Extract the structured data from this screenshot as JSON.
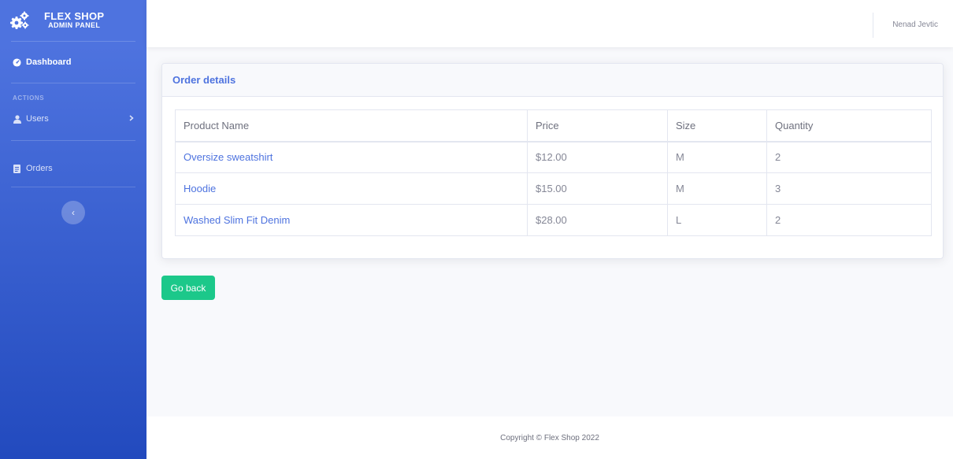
{
  "sidebar": {
    "brand_title": "FLEX SHOP",
    "brand_subtitle": "ADMIN PANEL",
    "dashboard_label": "Dashboard",
    "heading_actions": "ACTIONS",
    "users_label": "Users",
    "orders_label": "Orders",
    "toggle_glyph": "‹"
  },
  "topbar": {
    "user_name": "Nenad Jevtic"
  },
  "card": {
    "title": "Order details",
    "columns": [
      "Product Name",
      "Price",
      "Size",
      "Quantity"
    ],
    "rows": [
      {
        "product": "Oversize sweatshirt",
        "price": "$12.00",
        "size": "M",
        "quantity": "2"
      },
      {
        "product": "Hoodie",
        "price": "$15.00",
        "size": "M",
        "quantity": "3"
      },
      {
        "product": "Washed Slim Fit Denim",
        "price": "$28.00",
        "size": "L",
        "quantity": "2"
      }
    ]
  },
  "actions": {
    "go_back_label": "Go back"
  },
  "footer": {
    "copyright": "Copyright © Flex Shop 2022"
  },
  "colors": {
    "primary": "#4e73df",
    "success": "#1cc88a",
    "sidebar_bottom": "#224abe"
  }
}
